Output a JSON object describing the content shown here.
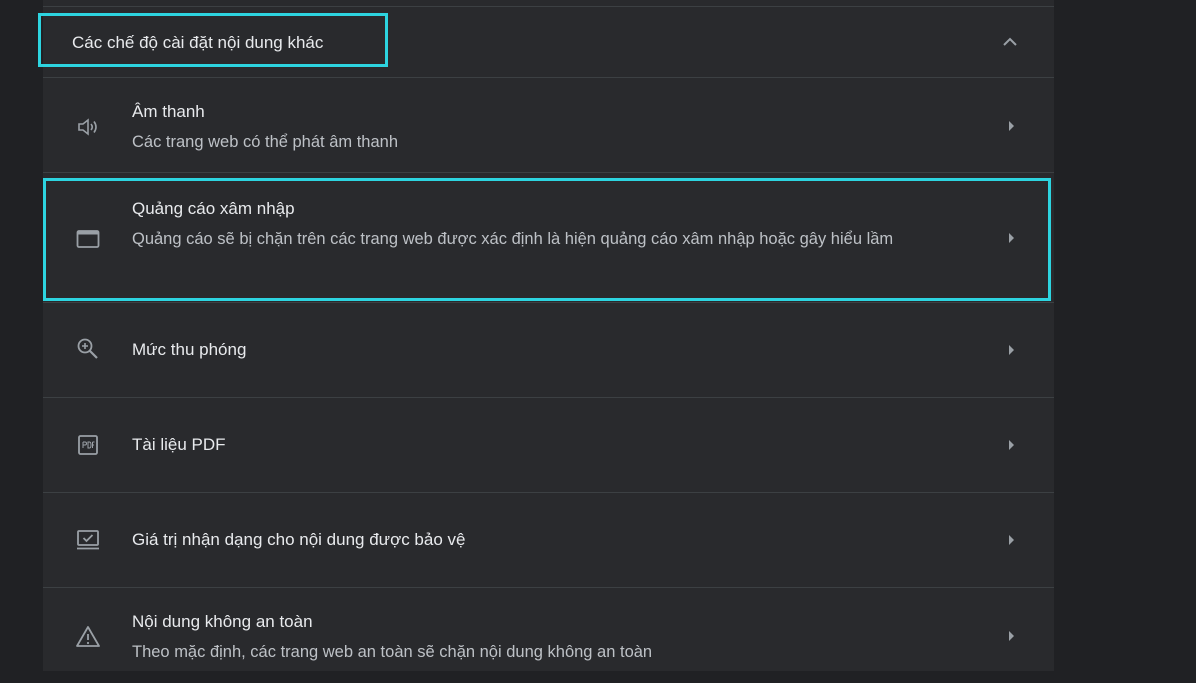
{
  "section": {
    "title": "Các chế độ cài đặt nội dung khác"
  },
  "rows": [
    {
      "icon": "speaker-icon",
      "title": "Âm thanh",
      "subtitle": "Các trang web có thể phát âm thanh"
    },
    {
      "icon": "intrusive-ads-icon",
      "title": "Quảng cáo xâm nhập",
      "subtitle": "Quảng cáo sẽ bị chặn trên các trang web được xác định là hiện quảng cáo xâm nhập hoặc gây hiểu lầm"
    },
    {
      "icon": "zoom-in-icon",
      "title": "Mức thu phóng"
    },
    {
      "icon": "pdf-icon",
      "title": "Tài liệu PDF"
    },
    {
      "icon": "protected-content-icon",
      "title": "Giá trị nhận dạng cho nội dung được bảo vệ"
    },
    {
      "icon": "warning-icon",
      "title": "Nội dung không an toàn",
      "subtitle": "Theo mặc định, các trang web an toàn sẽ chặn nội dung không an toàn"
    }
  ],
  "colors": {
    "background": "#202124",
    "panel": "#292a2d",
    "divider": "#3c4043",
    "text_primary": "#e8eaed",
    "text_secondary": "#bdc1c6",
    "icon": "#9aa0a6",
    "highlight": "#2dd4e0"
  }
}
